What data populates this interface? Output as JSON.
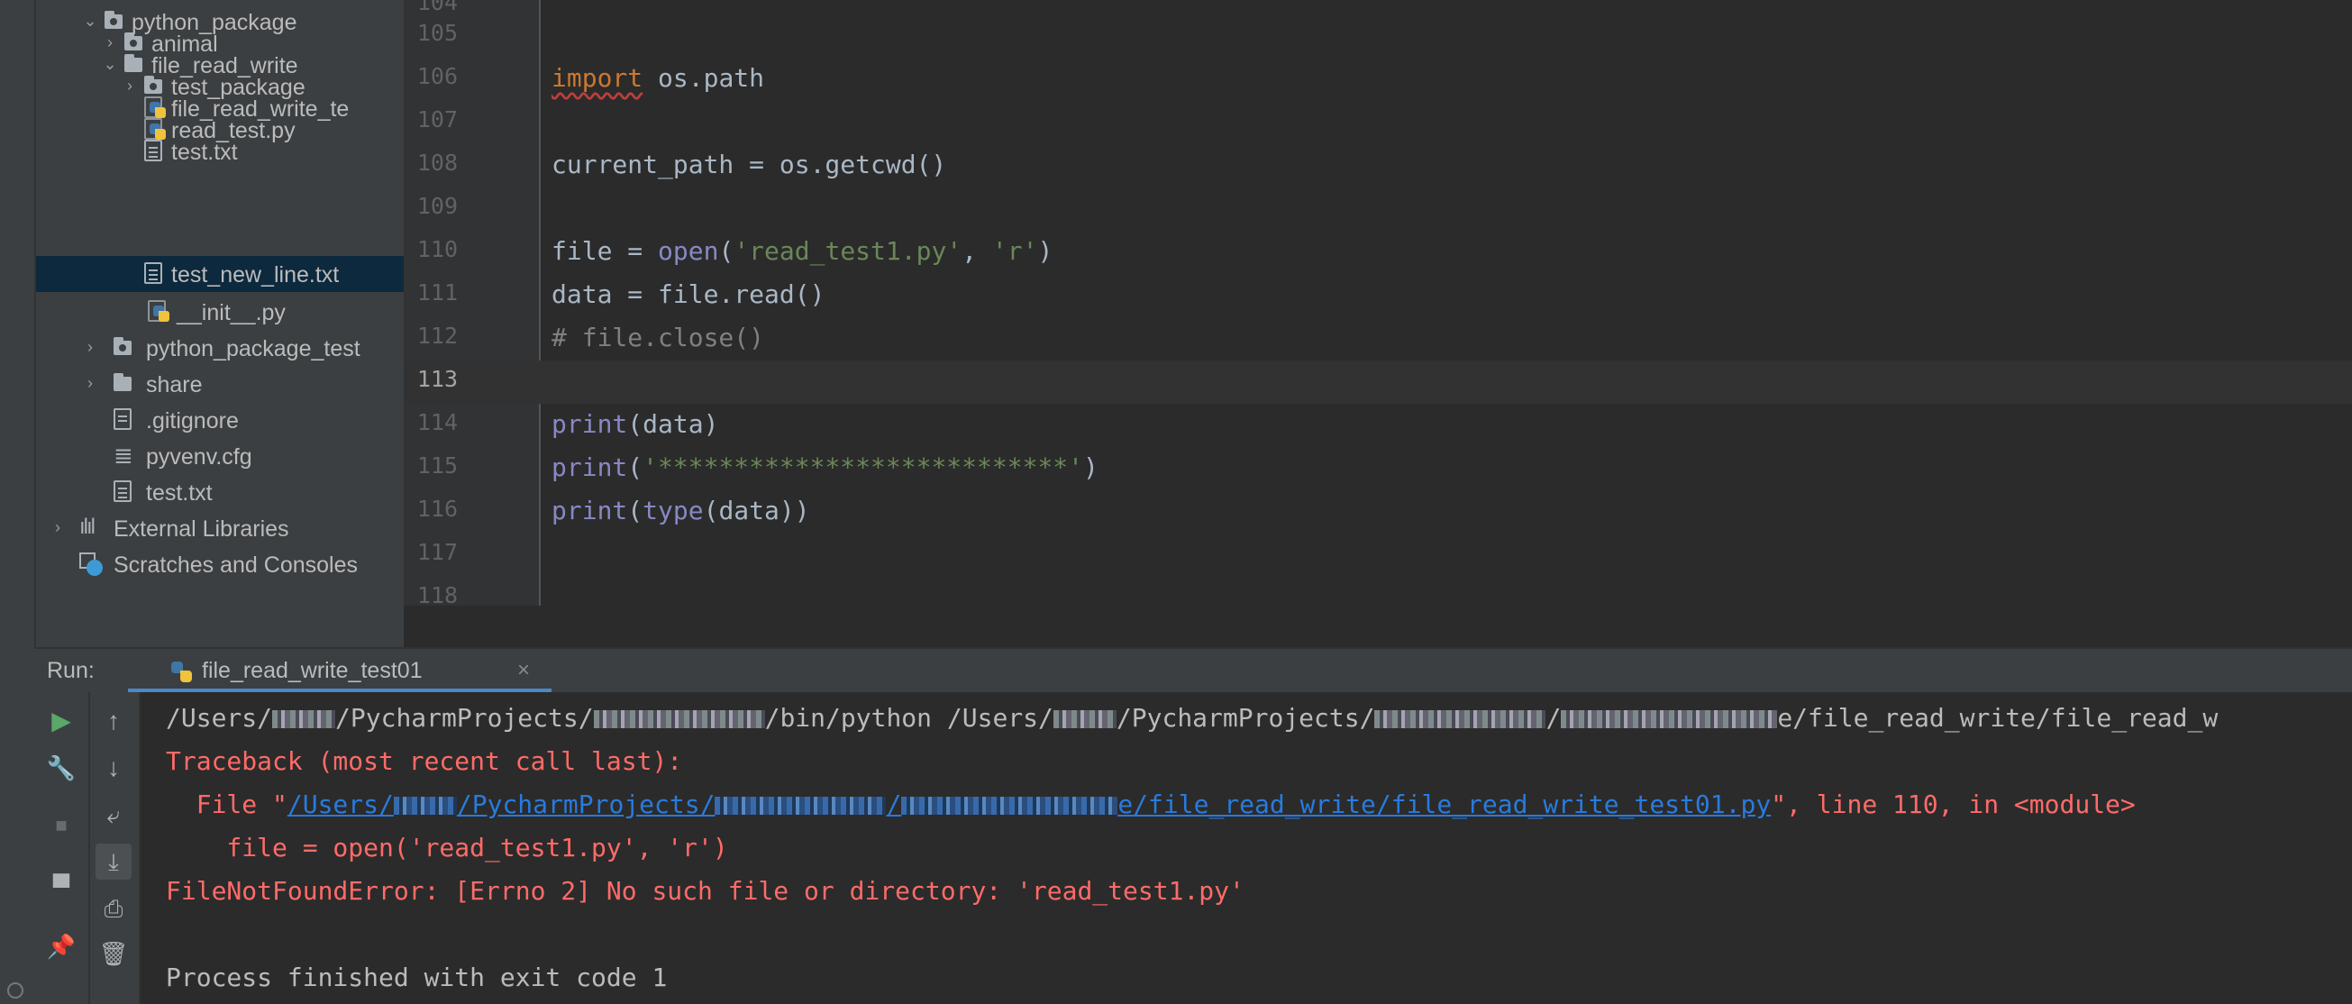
{
  "project_tree": {
    "items": [
      {
        "label": "python_package",
        "type": "package",
        "expanded": true
      },
      {
        "label": "animal",
        "type": "package",
        "expanded": false
      },
      {
        "label": "file_read_write",
        "type": "folder",
        "expanded": true
      },
      {
        "label": "test_package",
        "type": "package",
        "expanded": false
      },
      {
        "label": "file_read_write_te",
        "type": "python-file"
      },
      {
        "label": "read_test.py",
        "type": "python-file"
      },
      {
        "label": "test.txt",
        "type": "text-file"
      },
      {
        "label": "test_new_line.txt",
        "type": "text-file",
        "selected": true
      },
      {
        "label": "__init__.py",
        "type": "python-file"
      },
      {
        "label": "python_package_test",
        "type": "package",
        "expanded": false
      },
      {
        "label": "share",
        "type": "folder",
        "expanded": false
      },
      {
        "label": ".gitignore",
        "type": "ignore-file"
      },
      {
        "label": "pyvenv.cfg",
        "type": "config-file"
      },
      {
        "label": "test.txt",
        "type": "text-file"
      },
      {
        "label": "External Libraries",
        "type": "libraries",
        "expanded": false
      },
      {
        "label": "Scratches and Consoles",
        "type": "scratches"
      }
    ]
  },
  "editor": {
    "line_numbers": [
      "105",
      "106",
      "107",
      "108",
      "109",
      "110",
      "111",
      "112",
      "113",
      "114",
      "115",
      "116",
      "117",
      "118"
    ],
    "current_line": "113",
    "code": {
      "l106_kw": "import",
      "l106_rest": " os.path",
      "l108": "current_path = os.getcwd()",
      "l110_a": "file = ",
      "l110_fn": "open",
      "l110_b": "(",
      "l110_s1": "'read_test1.py'",
      "l110_c": ", ",
      "l110_s2": "'r'",
      "l110_d": ")",
      "l111": "data = file.read()",
      "l112": "# file.close()",
      "l114_fn": "print",
      "l114_rest": "(data)",
      "l115_fn": "print",
      "l115_a": "(",
      "l115_s": "'***************************'",
      "l115_b": ")",
      "l116_fn": "print",
      "l116_a": "(",
      "l116_fn2": "type",
      "l116_b": "(data))"
    }
  },
  "run_panel": {
    "label": "Run:",
    "tab_label": "file_read_write_test01",
    "tab_close": "×",
    "console": {
      "cmd_a": "/Users/",
      "cmd_b": "/PycharmProjects/",
      "cmd_c": "/bin/python /Users/",
      "cmd_d": "/PycharmProjects/",
      "cmd_e": "/",
      "cmd_f": "e/file_read_write/file_read_w",
      "traceback": "Traceback (most recent call last):",
      "file_prefix": "  File \"",
      "link_a": "/Users/",
      "link_b": "/PycharmProjects/",
      "link_c": "/",
      "link_d": "e/file_read_write/file_read_write_test01.py",
      "file_suffix": "\", line 110, in <module>",
      "code_line": "    file = open('read_test1.py', 'r')",
      "error": "FileNotFoundError: [Errno 2] No such file or directory: 'read_test1.py'",
      "exit": "Process finished with exit code 1"
    }
  }
}
